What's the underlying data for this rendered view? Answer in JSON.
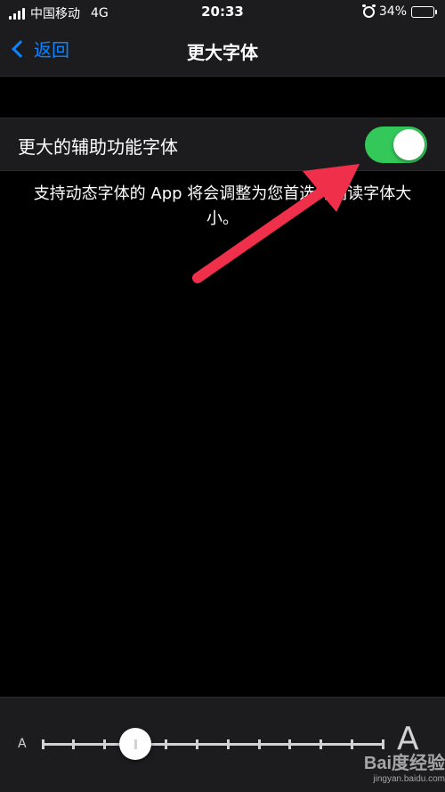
{
  "status_bar": {
    "carrier": "中国移动",
    "network": "4G",
    "time": "20:33",
    "battery": "34%",
    "battery_level": 0.34,
    "icons": [
      "signal-icon",
      "alarm-icon",
      "battery-icon"
    ]
  },
  "nav": {
    "back_label": "返回",
    "title": "更大字体",
    "accent_color": "#0a84ff"
  },
  "settings": {
    "row_label": "更大的辅助功能字体",
    "toggle_on": true,
    "toggle_color": "#34c759",
    "footer_note": "支持动态字体的 App 将会调整为您首选的阅读字体大小。"
  },
  "slider": {
    "small_label": "A",
    "large_label": "A",
    "tick_count": 12,
    "selected_step": 3
  },
  "watermark": {
    "main": "Bai度经验",
    "sub": "jingyan.baidu.com"
  },
  "annotation": {
    "color": "#f0304a"
  }
}
